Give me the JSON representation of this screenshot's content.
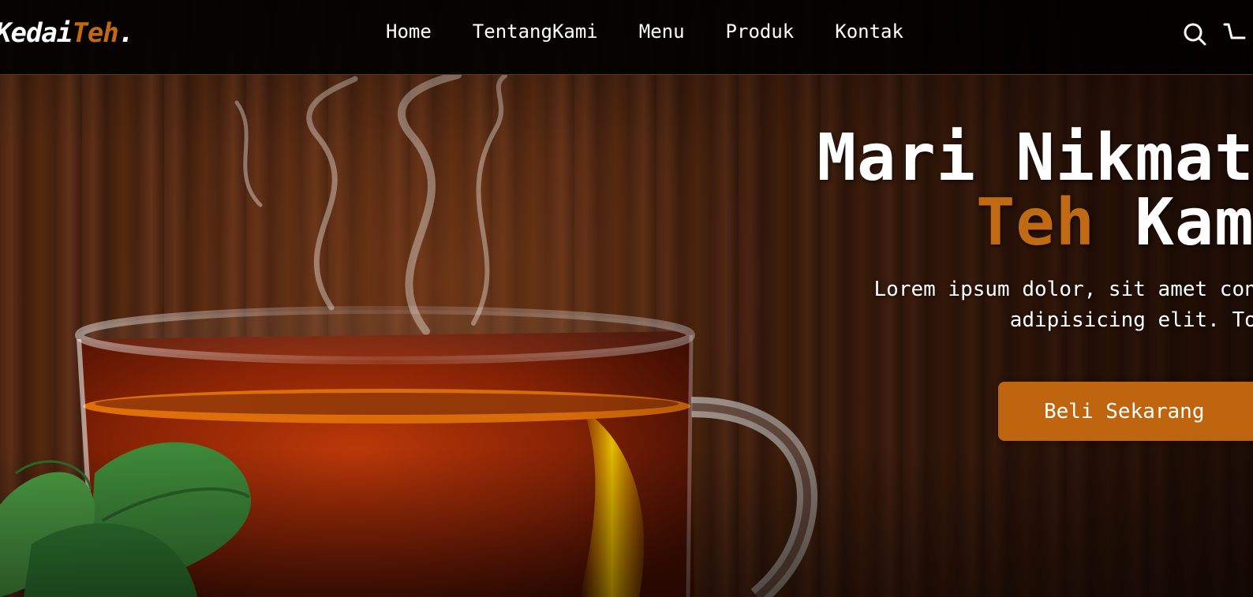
{
  "navbar": {
    "logo_main": "Kedai",
    "logo_accent": "Teh",
    "logo_dot": ".",
    "links": [
      "Home",
      "TentangKami",
      "Menu",
      "Produk",
      "Kontak"
    ],
    "icons": [
      "search-icon",
      "cart-icon"
    ]
  },
  "hero": {
    "title_line1": "Mari Nikmati",
    "title_accent": "Teh",
    "title_line2_rest": " Kami",
    "description_line1": "Lorem ipsum dolor, sit amet consectetur",
    "description_line2": "adipisicing elit. Totam, rem",
    "cta_label": "Beli Sekarang"
  },
  "colors": {
    "accent": "#c06a14",
    "button": "#bf6510",
    "navbar": "#020100",
    "text": "#ffffff"
  }
}
